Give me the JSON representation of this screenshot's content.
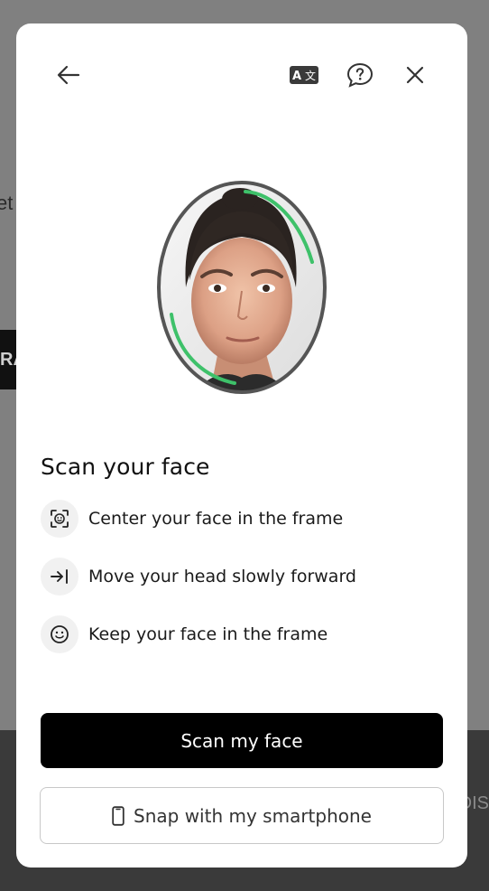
{
  "background": {
    "fragment_text": "et",
    "dark_button_text": "RA",
    "footer_text": "DIS"
  },
  "header": {
    "back_icon": "arrow-left-icon",
    "translate_icon": "translate-icon",
    "help_icon": "help-bubble-icon",
    "close_icon": "close-icon"
  },
  "colors": {
    "accent_green": "#3ec16a",
    "primary_button": "#000000",
    "step_icon_bg": "#f1f1f1"
  },
  "content": {
    "title": "Scan your face",
    "steps": [
      {
        "icon": "face-scan-icon",
        "text": "Center your face in the frame"
      },
      {
        "icon": "arrow-to-line-icon",
        "text": "Move your head slowly forward"
      },
      {
        "icon": "smiley-icon",
        "text": "Keep your face in the frame"
      }
    ]
  },
  "actions": {
    "primary_label": "Scan my face",
    "secondary_label": "Snap with my smartphone",
    "secondary_icon": "smartphone-icon"
  }
}
